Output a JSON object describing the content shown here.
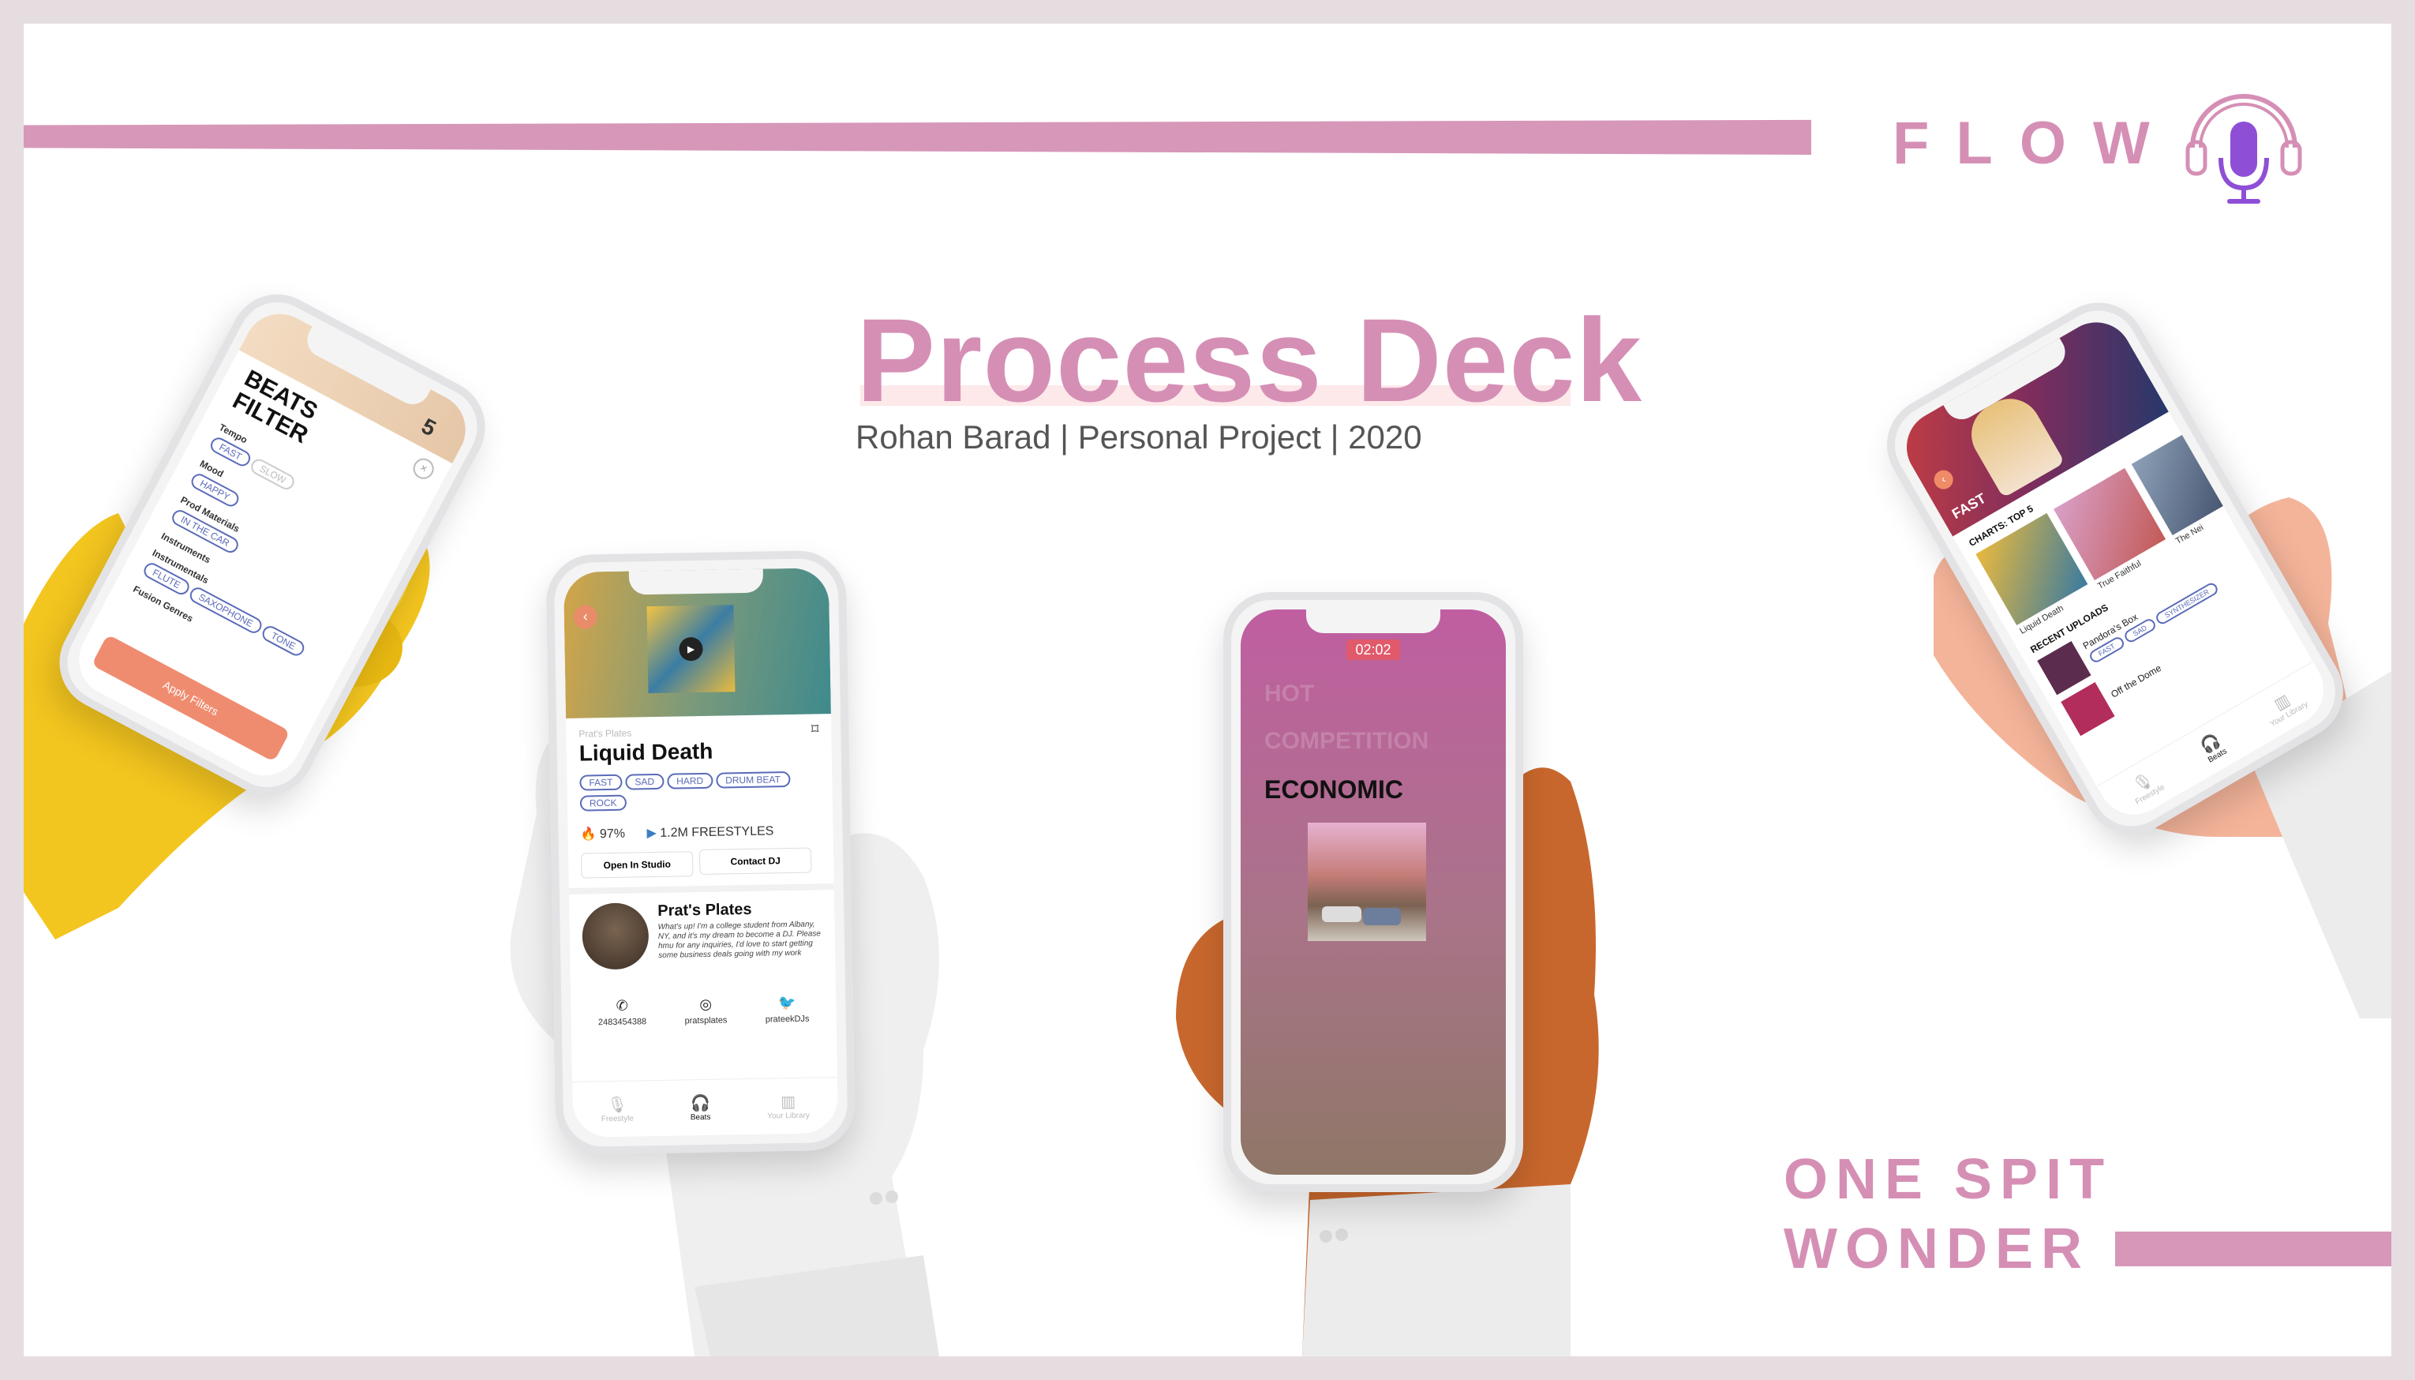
{
  "brand": {
    "name": "FLOW"
  },
  "deck": {
    "title": "Process Deck",
    "subtitle": "Rohan Barad | Personal Project | 2020"
  },
  "tagline": {
    "line1": "ONE SPIT",
    "line2": "WONDER"
  },
  "colors": {
    "accent_pink": "#d797b9",
    "logo_purple": "#8e4fd6",
    "filter_button": "#ef8c70"
  },
  "phone_filter": {
    "header_badge": "5",
    "title_line1": "BEATS",
    "title_line2": "FILTER",
    "sections": [
      {
        "label": "Tempo",
        "tags": [
          {
            "text": "FAST",
            "on": true
          },
          {
            "text": "SLOW",
            "on": false
          }
        ]
      },
      {
        "label": "Mood",
        "tags": [
          {
            "text": "HAPPY",
            "on": true
          }
        ]
      },
      {
        "label": "Prod Materials",
        "tags": [
          {
            "text": "IN THE CAR",
            "on": true
          }
        ]
      },
      {
        "label": "Instruments",
        "tags": []
      },
      {
        "label": "Instrumentals",
        "tags": [
          {
            "text": "FLUTE",
            "on": true
          },
          {
            "text": "SAXOPHONE",
            "on": true
          },
          {
            "text": "TONE",
            "on": true
          }
        ]
      },
      {
        "label": "Fusion Genres",
        "tags": []
      }
    ],
    "apply_button": "Apply Filters"
  },
  "phone_beat": {
    "producer_small": "Prat's Plates",
    "track_title": "Liquid Death",
    "tags": [
      "FAST",
      "SAD",
      "HARD",
      "DRUM BEAT",
      "ROCK"
    ],
    "fire_stat": "97%",
    "freestyles": "1.2M FREESTYLES",
    "btn_studio": "Open In Studio",
    "btn_contact": "Contact DJ",
    "profile_name": "Prat's Plates",
    "bio": "What's up! I'm a college student from Albany, NY, and it's my dream to become a DJ. Please hmu for any inquiries, I'd love to start getting some business deals going with my work",
    "contacts": [
      {
        "icon": "phone-icon",
        "text": "2483454388"
      },
      {
        "icon": "instagram-icon",
        "text": "pratsplates"
      },
      {
        "icon": "twitter-icon",
        "text": "prateekDJs"
      }
    ],
    "nav": [
      "Freestyle",
      "Beats",
      "Your Library"
    ]
  },
  "phone_timer": {
    "time": "02:02",
    "options": [
      "HOT",
      "COMPETITION",
      "ECONOMIC"
    ],
    "selected": "ECONOMIC"
  },
  "phone_charts": {
    "hero_label": "FAST",
    "charts_label": "CHARTS: TOP 5",
    "chart_items": [
      "Liquid Death",
      "True Faithful",
      "The Nei"
    ],
    "recent_label": "RECENT UPLOADS",
    "recent_items": [
      "Pandora's Box",
      "Off the Dome"
    ],
    "recent_tags": [
      "FAST",
      "SAD",
      "SYNTHESIZER"
    ],
    "nav": [
      "Freestyle",
      "Beats",
      "Your Library"
    ]
  }
}
